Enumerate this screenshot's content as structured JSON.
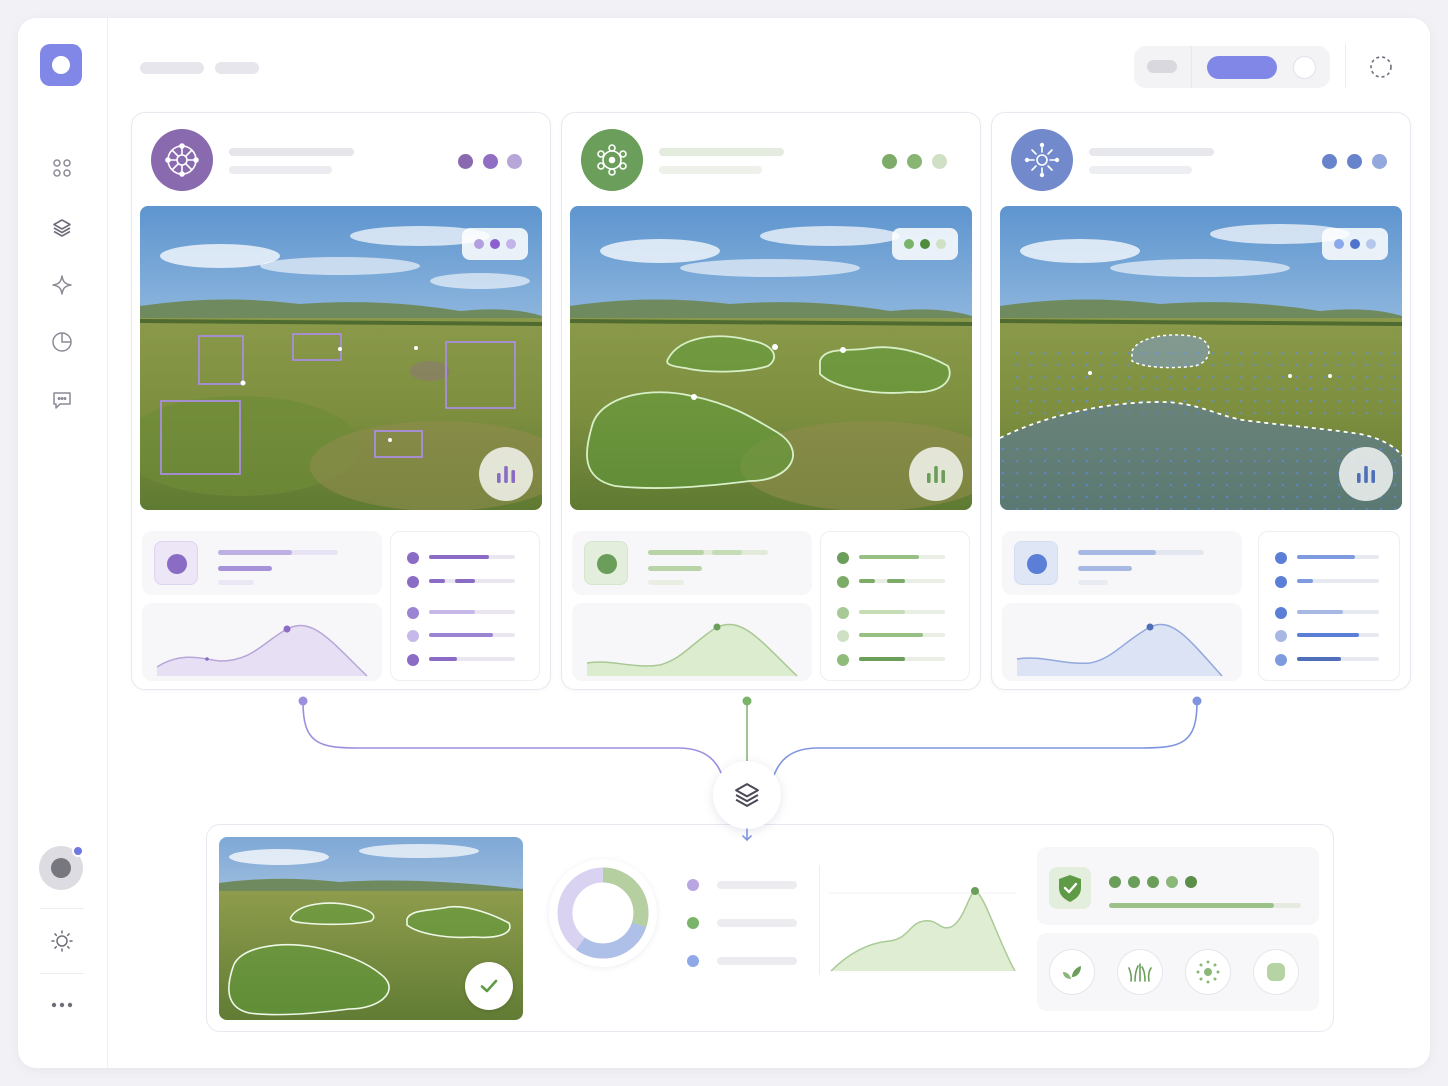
{
  "theme": {
    "accent": "#8087e6",
    "purple": "#8b6cc4",
    "green": "#6b9e5a",
    "blue": "#6683cc"
  },
  "sidebar": {
    "logo": "app-logo",
    "items": [
      {
        "icon": "grid-icon"
      },
      {
        "icon": "layers-icon"
      },
      {
        "icon": "sparkle-icon"
      },
      {
        "icon": "pie-chart-icon"
      },
      {
        "icon": "chat-icon"
      }
    ],
    "footer": [
      {
        "icon": "avatar"
      },
      {
        "icon": "sun-icon"
      },
      {
        "icon": "more-icon"
      }
    ]
  },
  "header": {
    "toggle_active_index": 1,
    "refresh_icon": "loading-icon"
  },
  "cards": [
    {
      "id": "object-detection",
      "icon": "network-icon",
      "color": "#8b6cc4",
      "light": "#e4dcf3",
      "overlay": "bounding-boxes"
    },
    {
      "id": "segmentation",
      "icon": "molecule-icon",
      "color": "#6b9e5a",
      "light": "#dceccf",
      "overlay": "segmentation-masks"
    },
    {
      "id": "point-cloud",
      "icon": "burst-icon",
      "color": "#6683cc",
      "light": "#dbe3f5",
      "overlay": "point-grid"
    }
  ],
  "merge": {
    "icon": "layers-icon"
  },
  "result": {
    "status_icon": "check-icon",
    "donut": [
      {
        "color": "#b5cfa0",
        "value": 30
      },
      {
        "color": "#aebfe8",
        "value": 30
      },
      {
        "color": "#d9d2f0",
        "value": 40
      }
    ],
    "legend_colors": [
      "#b8a6e0",
      "#7ab36a",
      "#8ea8e8"
    ],
    "score_dots": 5,
    "score_progress": 0.86,
    "feature_icons": [
      "leaf-icon",
      "grass-icon",
      "pollen-icon",
      "patch-icon"
    ]
  }
}
